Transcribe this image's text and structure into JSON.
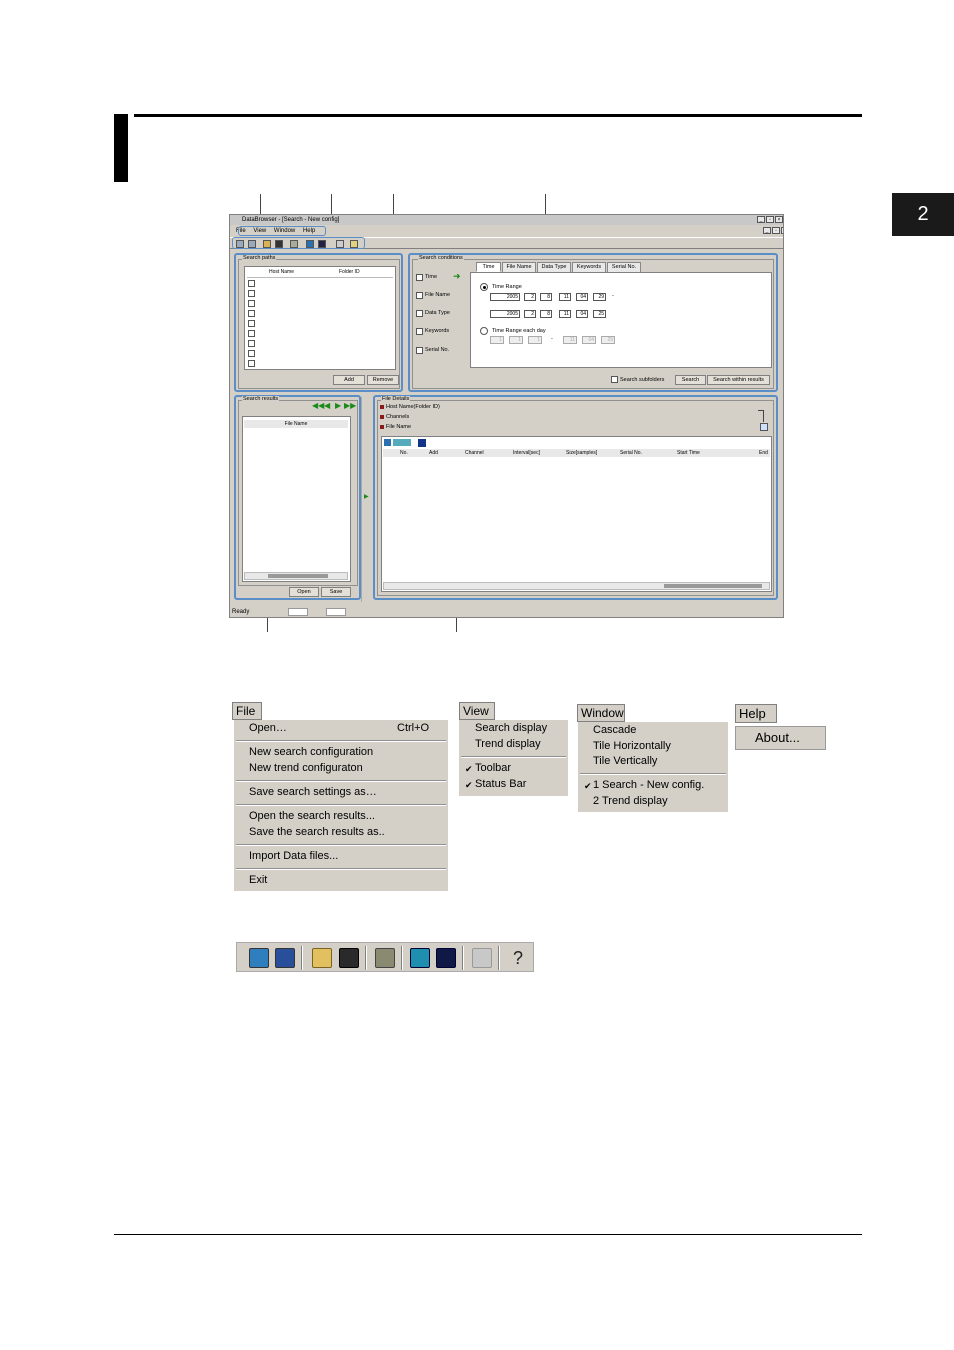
{
  "page": {
    "chapter_number": "2"
  },
  "app": {
    "title": "DataBrowser - [Search - New config]",
    "menus": [
      "File",
      "View",
      "Window",
      "Help"
    ],
    "search_paths": {
      "title": "Search paths",
      "columns": [
        "Host Name",
        "Folder ID"
      ],
      "add_label": "Add",
      "remove_label": "Remove"
    },
    "search_conditions": {
      "title": "Search conditions",
      "checks": [
        "Time",
        "File Name",
        "Data Type",
        "Keywords",
        "Serial No."
      ],
      "tabs": [
        "Time",
        "File Name",
        "Data Type",
        "Keywords",
        "Serial No."
      ],
      "time_range_label": "Time Range",
      "time_range_each_day_label": "Time Range each day",
      "start": {
        "year": "2005",
        "month": "2",
        "day": "8",
        "hour": "11",
        "minute": "04",
        "second": "29"
      },
      "end": {
        "year": "2005",
        "month": "2",
        "day": "8",
        "hour": "11",
        "minute": "04",
        "second": "25"
      },
      "each_day_start": [
        "1",
        "1",
        "1"
      ],
      "each_day_end": [
        "1",
        "1",
        "1"
      ],
      "each_day_times": [
        "11",
        "04",
        "29"
      ],
      "search_subfolders_label": "Search subfolders",
      "search_label": "Search",
      "search_within_label": "Search within results",
      "range_dash": "-"
    },
    "search_results": {
      "title": "Search results",
      "column": "File Name",
      "open_label": "Open",
      "save_label": "Save"
    },
    "file_details": {
      "title": "File Details",
      "items": [
        "Host Name(Folder ID)",
        "Channels",
        "File Name"
      ],
      "columns": [
        "No.",
        "Add",
        "Channel",
        "Interval[sec]",
        "Size[samples]",
        "Serial No.",
        "Start Time",
        "End"
      ]
    },
    "status": "Ready"
  },
  "menus": {
    "file": {
      "title": "File",
      "items": [
        {
          "label": "Open…",
          "shortcut": "Ctrl+O"
        },
        {
          "label": "New search configuration"
        },
        {
          "label": "New trend configuraton"
        },
        {
          "label": "Save search settings as…"
        },
        {
          "label": "Open the search results..."
        },
        {
          "label": "Save the search results as.."
        },
        {
          "label": "Import Data files..."
        },
        {
          "label": "Exit"
        }
      ]
    },
    "view": {
      "title": "View",
      "items": [
        "Search display",
        "Trend display",
        "Toolbar",
        "Status Bar"
      ]
    },
    "window": {
      "title": "Window",
      "items": [
        "Cascade",
        "Tile Horizontally",
        "Tile Vertically",
        "1 Search - New config.",
        "2 Trend display"
      ]
    },
    "help": {
      "title": "Help",
      "items": [
        "About..."
      ]
    }
  },
  "toolbar_icons": [
    "new-search-icon",
    "new-trend-icon",
    "open-folder-icon",
    "save-icon",
    "import-icon",
    "search-display-icon",
    "trend-display-icon",
    "print-icon",
    "help-icon"
  ]
}
